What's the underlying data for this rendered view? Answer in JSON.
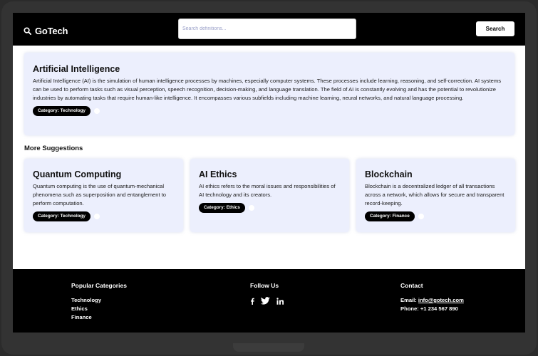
{
  "header": {
    "logo_text": "GoTech",
    "search_placeholder": "Search definitions...",
    "search_button": "Search"
  },
  "main_definition": {
    "title": "Artificial Intelligence",
    "description": "Artificial Intelligence (AI) is the simulation of human intelligence processes by machines, especially computer systems. These processes include learning, reasoning, and self-correction. AI systems can be used to perform tasks such as visual perception, speech recognition, decision-making, and language translation. The field of AI is constantly evolving and has the potential to revolutionize industries by automating tasks that require human-like intelligence. It encompasses various subfields including machine learning, neural networks, and natural language processing.",
    "category": "Category: Technology"
  },
  "suggestions": {
    "heading": "More Suggestions",
    "items": [
      {
        "title": "Quantum Computing",
        "description": "Quantum computing is the use of quantum-mechanical phenomena such as superposition and entanglement to perform computation.",
        "category": "Category: Technology"
      },
      {
        "title": "AI Ethics",
        "description": "AI ethics refers to the moral issues and responsibilities of AI technology and its creators.",
        "category": "Category: Ethics"
      },
      {
        "title": "Blockchain",
        "description": "Blockchain is a decentralized ledger of all transactions across a network, which allows for secure and transparent record-keeping.",
        "category": "Category: Finance"
      }
    ]
  },
  "footer": {
    "categories_heading": "Popular Categories",
    "categories": [
      "Technology",
      "Ethics",
      "Finance"
    ],
    "follow_heading": "Follow Us",
    "social_icons": [
      "facebook-icon",
      "twitter-icon",
      "linkedin-icon"
    ],
    "contact_heading": "Contact",
    "email_label": "Email: ",
    "email": "info@gotech.com",
    "phone": "Phone: +1 234 567 890"
  },
  "colors": {
    "header_bg": "#000000",
    "card_bg": "#eceffd",
    "badge_bg": "#000000",
    "footer_bg": "#000000"
  }
}
